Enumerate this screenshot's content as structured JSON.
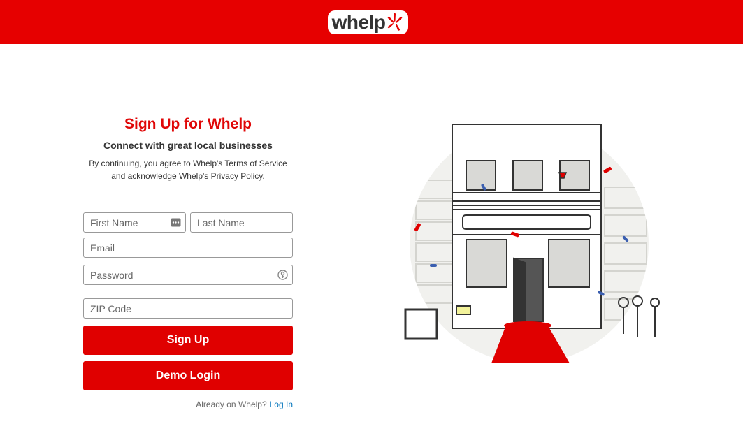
{
  "header": {
    "logo_text": "whelp",
    "brand_color": "#e60000"
  },
  "signup": {
    "title": "Sign Up for Whelp",
    "subtitle": "Connect with great local businesses",
    "legal_line1": "By continuing, you agree to Whelp's Terms of Service",
    "legal_line2": "and acknowledge Whelp's Privacy Policy.",
    "first_name_placeholder": "First Name",
    "last_name_placeholder": "Last Name",
    "email_placeholder": "Email",
    "password_placeholder": "Password",
    "zip_placeholder": "ZIP Code",
    "signup_button": "Sign Up",
    "demo_button": "Demo Login",
    "already_text": "Already on Whelp?",
    "login_link": "Log In",
    "button_color": "#e00000",
    "link_color": "#0073bb"
  },
  "icons": {
    "autofill": "contact-card-icon",
    "password": "key-icon",
    "logo_burst": "burst-icon"
  }
}
